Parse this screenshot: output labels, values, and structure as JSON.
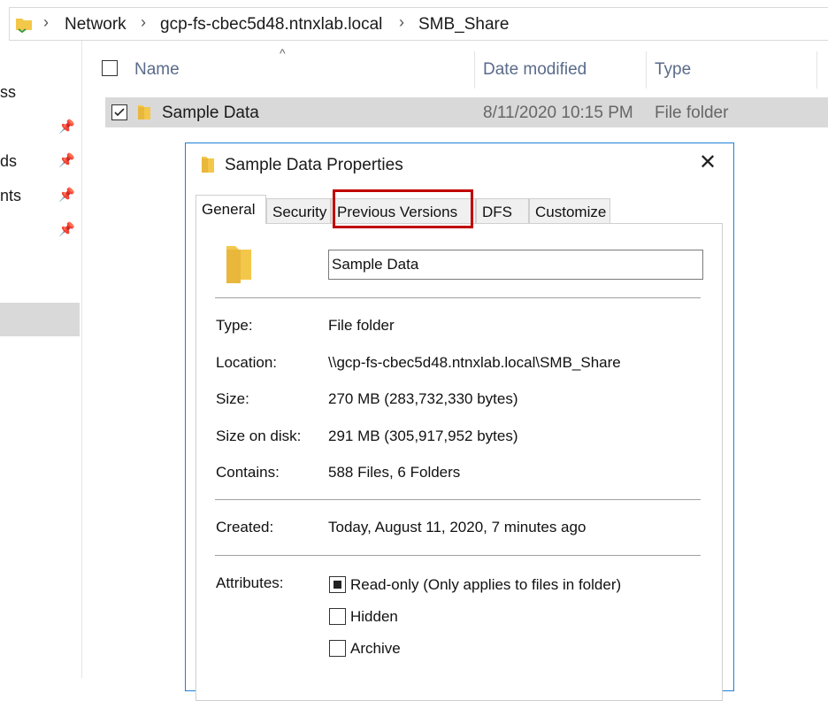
{
  "breadcrumb": [
    "Network",
    "gcp-fs-cbec5d48.ntnxlab.local",
    "SMB_Share"
  ],
  "nav": {
    "items": [
      "ss",
      "ds",
      "nts"
    ]
  },
  "columns": {
    "name": "Name",
    "date": "Date modified",
    "type": "Type"
  },
  "row": {
    "name": "Sample Data",
    "date": "8/11/2020 10:15 PM",
    "type": "File folder"
  },
  "dialog": {
    "title": "Sample Data Properties",
    "close": "✕",
    "tabs": [
      "General",
      "Security",
      "Previous Versions",
      "DFS",
      "Customize"
    ],
    "name_value": "Sample Data",
    "fields": {
      "type_label": "Type:",
      "type_value": "File folder",
      "location_label": "Location:",
      "location_value": "\\\\gcp-fs-cbec5d48.ntnxlab.local\\SMB_Share",
      "size_label": "Size:",
      "size_value": "270 MB (283,732,330 bytes)",
      "disk_label": "Size on disk:",
      "disk_value": "291 MB (305,917,952 bytes)",
      "contains_label": "Contains:",
      "contains_value": "588 Files, 6 Folders",
      "created_label": "Created:",
      "created_value": "Today, August 11, 2020, 7 minutes ago",
      "attributes_label": "Attributes:"
    },
    "attributes": {
      "readonly": "Read-only (Only applies to files in folder)",
      "hidden": "Hidden",
      "archive": "Archive"
    }
  },
  "colors": {
    "highlight": "#c00000",
    "folder": "#f3c74a",
    "selection": "#d9d9d9",
    "dialog_border": "#1e7fd8"
  },
  "icons": [
    "folder-icon",
    "chevron-right-icon",
    "pin-icon",
    "sort-up-icon",
    "close-icon",
    "checkbox-icon"
  ]
}
